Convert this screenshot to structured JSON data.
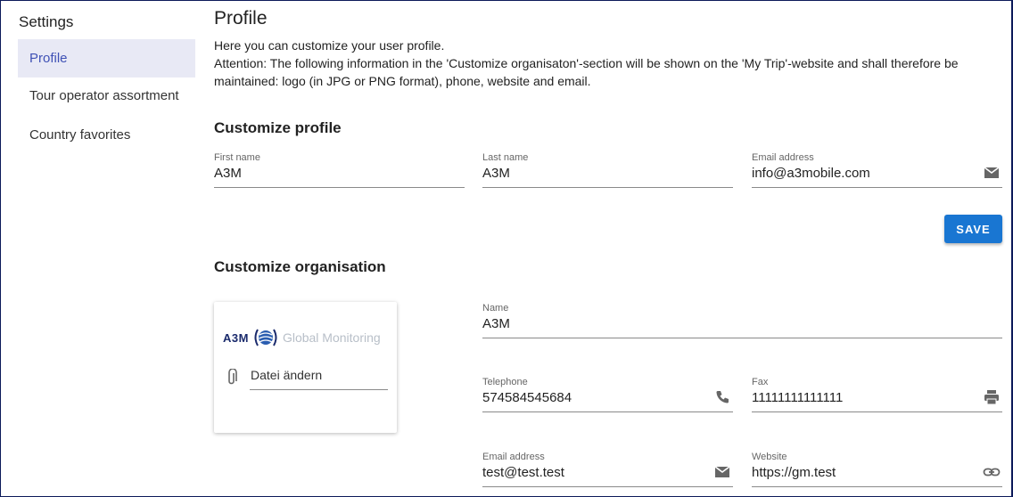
{
  "sidebar": {
    "title": "Settings",
    "items": [
      {
        "label": "Profile",
        "active": true
      },
      {
        "label": "Tour operator assortment",
        "active": false
      },
      {
        "label": "Country favorites",
        "active": false
      }
    ]
  },
  "main": {
    "title": "Profile",
    "description_line1": "Here you can customize your user profile.",
    "description_line2": "Attention: The following information in the 'Customize organisaton'-section will be shown on the 'My Trip'-website and shall therefore be maintained: logo (in JPG or PNG format), phone, website and email."
  },
  "profile": {
    "section_title": "Customize profile",
    "first_name": {
      "label": "First name",
      "value": "A3M"
    },
    "last_name": {
      "label": "Last name",
      "value": "A3M"
    },
    "email": {
      "label": "Email address",
      "value": "info@a3mobile.com"
    },
    "save_label": "SAVE"
  },
  "organisation": {
    "section_title": "Customize organisation",
    "logo": {
      "brand": "A3M",
      "tagline": "Global Monitoring"
    },
    "file_label": "Datei ändern",
    "name": {
      "label": "Name",
      "value": "A3M"
    },
    "telephone": {
      "label": "Telephone",
      "value": "574584545684"
    },
    "fax": {
      "label": "Fax",
      "value": "11111111111111"
    },
    "email": {
      "label": "Email address",
      "value": "test@test.test"
    },
    "website": {
      "label": "Website",
      "value": "https://gm.test"
    }
  },
  "icons": {
    "email": "mail-icon",
    "phone": "phone-icon",
    "fax": "printer-icon",
    "website": "link-icon",
    "attachment": "paperclip-icon"
  },
  "colors": {
    "accent": "#1976d2",
    "active_nav_bg": "#e8e9f5",
    "active_nav_text": "#3f51b5"
  }
}
